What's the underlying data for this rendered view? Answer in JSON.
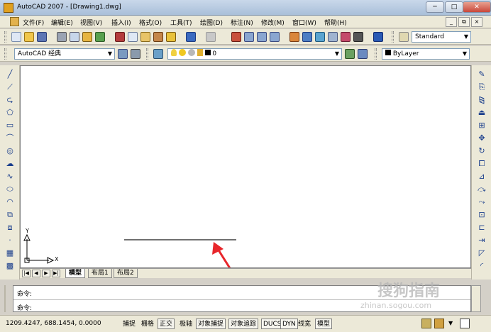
{
  "window": {
    "title": "AutoCAD 2007 - [Drawing1.dwg]",
    "minimize": "─",
    "maximize": "□",
    "close": "✕"
  },
  "menu": {
    "items": [
      "文件(F)",
      "编辑(E)",
      "视图(V)",
      "插入(I)",
      "格式(O)",
      "工具(T)",
      "绘图(D)",
      "标注(N)",
      "修改(M)",
      "窗口(W)",
      "帮助(H)"
    ],
    "doc_minimize": "_",
    "doc_restore": "⧉",
    "doc_close": "×"
  },
  "toolbar1": {
    "text_style": "Standard"
  },
  "toolbar2": {
    "workspace": "AutoCAD 经典",
    "layer": "0",
    "color": "ByLayer"
  },
  "canvas": {
    "ucs_y": "Y",
    "ucs_x": "X"
  },
  "tabs": {
    "nav": [
      "|◀",
      "◀",
      "▶",
      "▶|"
    ],
    "items": [
      "模型",
      "布局1",
      "布局2"
    ],
    "active": "模型"
  },
  "command": {
    "prompt1": "命令:",
    "prompt2": "命令:"
  },
  "status": {
    "coords": "1209.4247, 688.1454, 0.0000",
    "buttons": [
      "捕捉",
      "栅格",
      "正交",
      "极轴",
      "对象捕捉",
      "对象追踪",
      "DUCS",
      "DYN",
      "线宽",
      "模型"
    ],
    "on": [
      "正交",
      "对象捕捉",
      "对象追踪",
      "DUCS",
      "DYN",
      "模型"
    ]
  },
  "watermark": {
    "brand": "搜狗指南",
    "url": "zhinan.sogou.com"
  },
  "colors": {
    "accent": "#e8262b",
    "line": "#404040"
  }
}
